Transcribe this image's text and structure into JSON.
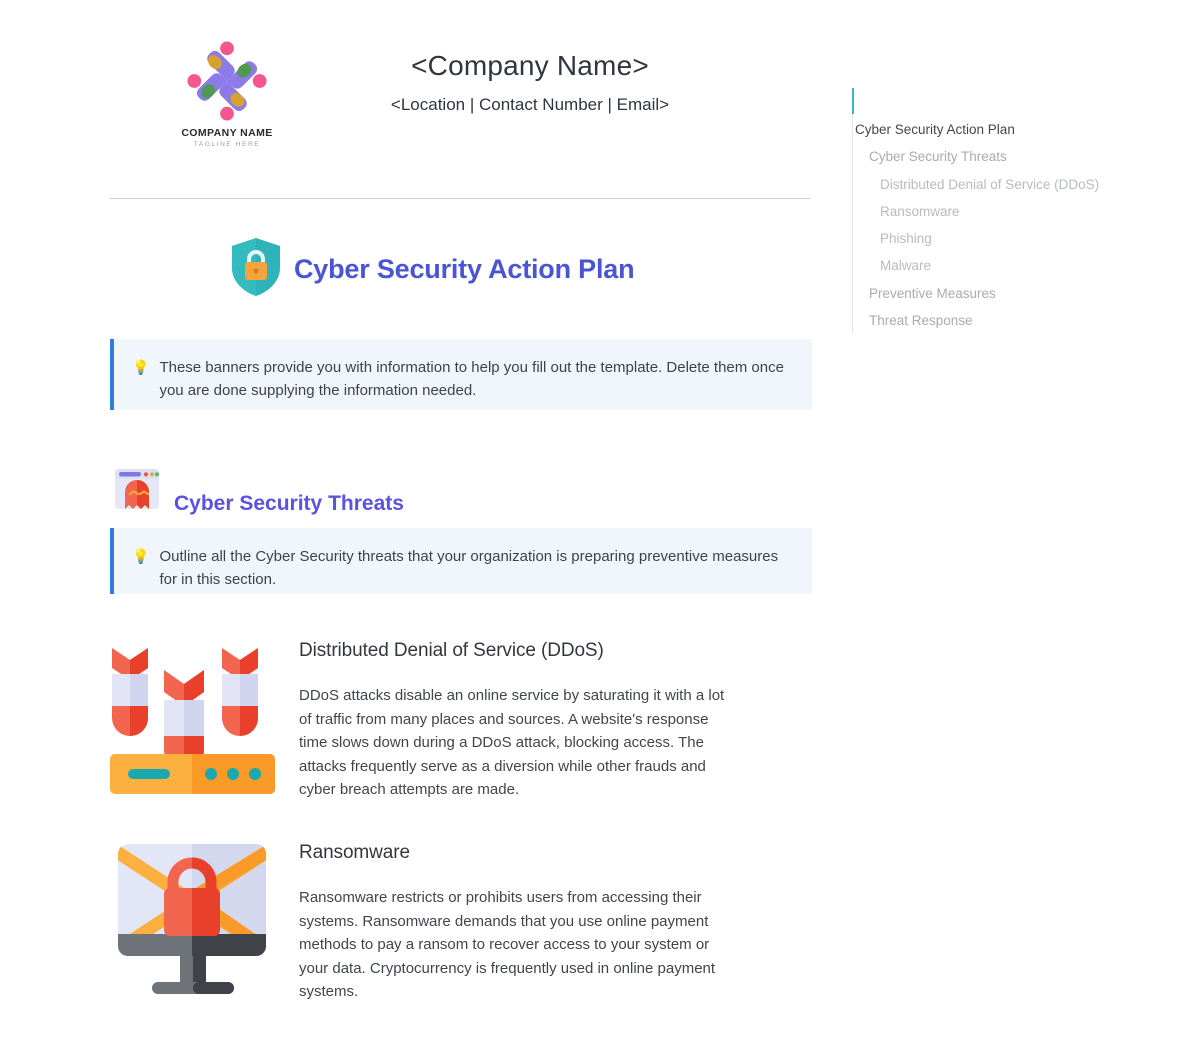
{
  "letterhead": {
    "logo": {
      "icon": "pinwheel-logo-icon",
      "name": "COMPANY NAME",
      "tagline": "TAGLINE HERE"
    },
    "company_name": "<Company Name>",
    "company_meta": "<Location | Contact Number | Email>"
  },
  "document": {
    "title": "Cyber Security Action Plan",
    "title_icon": "shield-lock-icon",
    "title_color": "#4a55d6"
  },
  "banners": [
    {
      "icon": "lightbulb-icon",
      "text": "These banners provide you with information to help you fill out the template. Delete them once you are done supplying the information needed.",
      "border_color": "#2f7de1",
      "background_color": "#f1f6fc"
    },
    {
      "icon": "lightbulb-icon",
      "text": "Outline all the Cyber Security threats that your organization is preparing preventive measures for in this section.",
      "border_color": "#2f7de1",
      "background_color": "#f1f6fc"
    }
  ],
  "section": {
    "icon": "browser-ghost-icon",
    "title": "Cyber Security Threats",
    "title_color": "#5a52e0"
  },
  "threats": [
    {
      "icon": "ddos-bombs-server-icon",
      "title": "Distributed Denial of Service (DDoS)",
      "description": "DDoS attacks disable an online service by saturating it with a lot of traffic from many places and sources. A website's response time slows down during a DDoS attack, blocking access. The attacks frequently serve as a diversion while other frauds and cyber breach attempts are made."
    },
    {
      "icon": "ransomware-monitor-lock-icon",
      "title": "Ransomware",
      "description": "Ransomware restricts or prohibits users from accessing their systems. Ransomware demands that you use online payment methods to pay a ransom to recover access to your system or your data. Cryptocurrency is frequently used in online payment systems."
    }
  ],
  "outline": {
    "accent_color": "#39b6c8",
    "items": [
      {
        "label": "Cyber Security Action Plan",
        "level": 0
      },
      {
        "label": "Cyber Security Threats",
        "level": 1
      },
      {
        "label": "Distributed Denial of Service (DDoS)",
        "level": 2
      },
      {
        "label": "Ransomware",
        "level": 2
      },
      {
        "label": "Phishing",
        "level": 2
      },
      {
        "label": "Malware",
        "level": 2
      },
      {
        "label": "Preventive Measures",
        "level": 1
      },
      {
        "label": "Threat Response",
        "level": 1
      }
    ]
  }
}
